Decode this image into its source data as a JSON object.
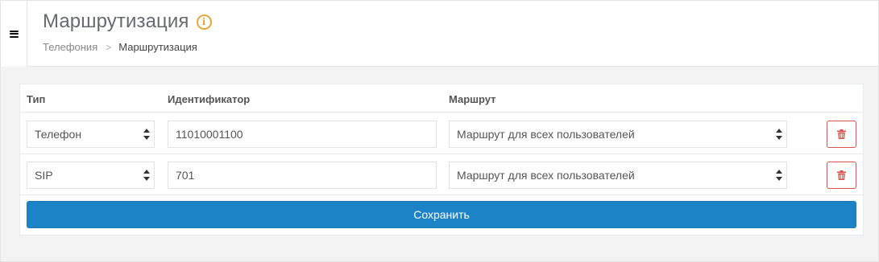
{
  "header": {
    "title": "Маршрутизация",
    "info_icon": "info-icon",
    "breadcrumb": {
      "parent": "Телефония",
      "separator": ">",
      "current": "Маршрутизация"
    }
  },
  "table": {
    "columns": {
      "type": "Тип",
      "identifier": "Идентификатор",
      "route": "Маршрут"
    },
    "rows": [
      {
        "type": "Телефон",
        "identifier": "11010001100",
        "route": "Маршрут для всех пользователей"
      },
      {
        "type": "SIP",
        "identifier": "701",
        "route": "Маршрут для всех пользователей"
      }
    ]
  },
  "actions": {
    "save_label": "Сохранить"
  },
  "colors": {
    "primary": "#1c84c6",
    "danger": "#d9534f",
    "info": "#e2a93a"
  }
}
